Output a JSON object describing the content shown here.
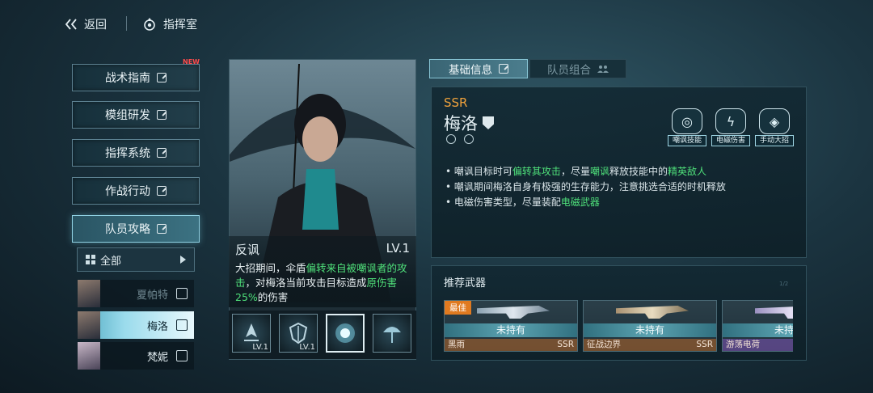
{
  "topbar": {
    "back_label": "返回",
    "hq_label": "指挥室"
  },
  "nav": {
    "items": [
      {
        "label": "战术指南",
        "badge": "NEW"
      },
      {
        "label": "模组研发"
      },
      {
        "label": "指挥系统"
      },
      {
        "label": "作战行动"
      },
      {
        "label": "队员攻略",
        "active": true
      }
    ]
  },
  "filter": {
    "label": "全部"
  },
  "members": [
    {
      "name": "夏帕特",
      "selected": false
    },
    {
      "name": "梅洛",
      "selected": true
    },
    {
      "name": "梵妮",
      "selected": false
    }
  ],
  "skill_card": {
    "name": "反讽",
    "level": "LV.1",
    "desc_1": "大招期间，伞盾",
    "desc_hl1": "偏转来自被嘲讽者的攻击",
    "desc_2": "，对梅洛当前攻击目标造成",
    "desc_hl2": "原伤害25%",
    "desc_3": "的伤害"
  },
  "skills": [
    {
      "icon": "wing-skill-icon",
      "level": "LV.1"
    },
    {
      "icon": "shield-skill-icon",
      "level": "LV.1"
    },
    {
      "icon": "orb-skill-icon",
      "level": "",
      "selected": true
    },
    {
      "icon": "umbrella-skill-icon",
      "level": ""
    }
  ],
  "tabs": {
    "basic": "基础信息",
    "team": "队员组合"
  },
  "character": {
    "rarity": "SSR",
    "name": "梅洛",
    "tags": [
      "嘲讽技能",
      "电磁伤害",
      "手动大招"
    ]
  },
  "bullets": [
    {
      "a": "嘲讽目标时可",
      "h1": "偏转其攻击",
      "b": "，尽量",
      "h2": "嘲讽",
      "c": "释放技能中的",
      "h3": "精英敌人",
      "d": ""
    },
    {
      "a": "嘲讽期间梅洛自身有极强的生存能力，注意挑选合适的时机释放"
    },
    {
      "a": "电磁伤害类型，尽量装配",
      "h1": "电磁武器"
    }
  ],
  "weapons_section": {
    "title": "推荐武器",
    "hint": "1/2",
    "items": [
      {
        "badge": "最佳",
        "status": "未持有",
        "name": "黑雨",
        "rarity": "SSR"
      },
      {
        "badge": "",
        "status": "未持有",
        "name": "征战边界",
        "rarity": "SSR"
      },
      {
        "badge": "",
        "status": "未持有",
        "name": "游荡电荷",
        "rarity": ""
      }
    ]
  },
  "colors": {
    "highlight": "#4fe07a",
    "rarity": "#f0a23c",
    "badge_new": "#ff4b4b"
  }
}
